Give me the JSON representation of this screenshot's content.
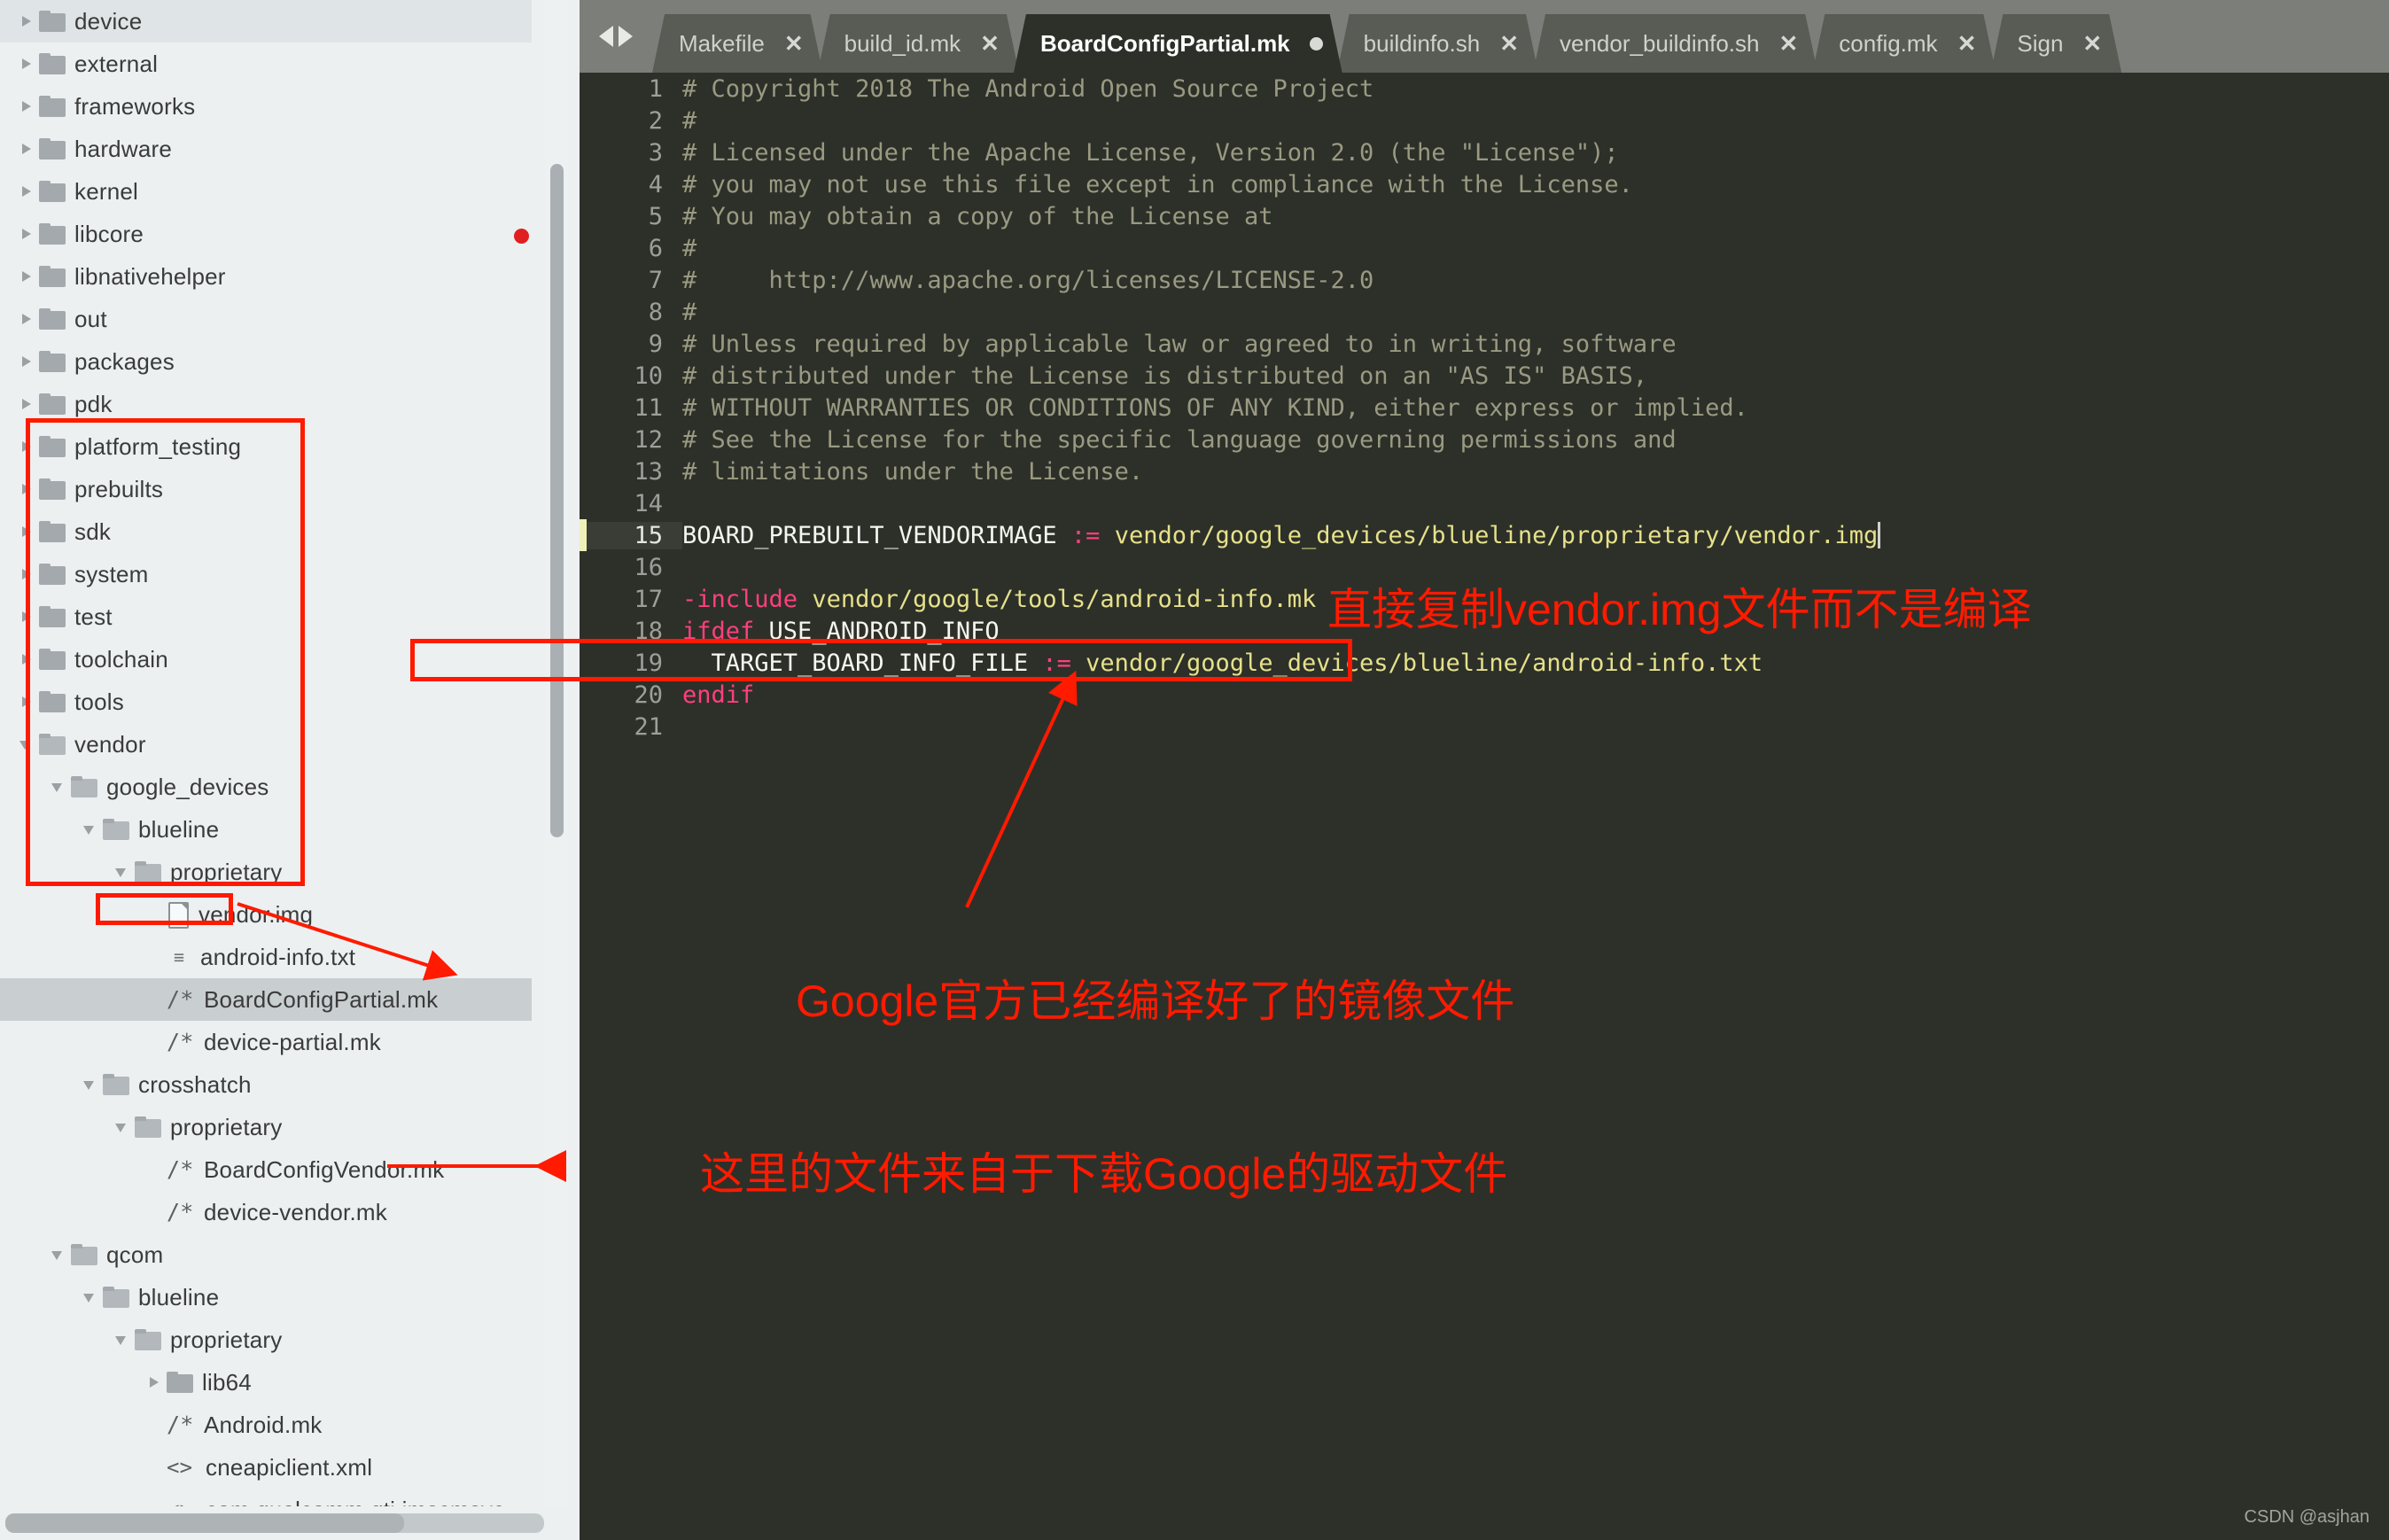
{
  "tree": {
    "items": [
      {
        "label": "device",
        "type": "folder",
        "depth": 1,
        "state": "collapsed",
        "selected": false,
        "hover": true,
        "error": false
      },
      {
        "label": "external",
        "type": "folder",
        "depth": 1,
        "state": "collapsed",
        "selected": false,
        "hover": false,
        "error": false
      },
      {
        "label": "frameworks",
        "type": "folder",
        "depth": 1,
        "state": "collapsed",
        "selected": false,
        "hover": false,
        "error": false
      },
      {
        "label": "hardware",
        "type": "folder",
        "depth": 1,
        "state": "collapsed",
        "selected": false,
        "hover": false,
        "error": false
      },
      {
        "label": "kernel",
        "type": "folder",
        "depth": 1,
        "state": "collapsed",
        "selected": false,
        "hover": false,
        "error": false
      },
      {
        "label": "libcore",
        "type": "folder",
        "depth": 1,
        "state": "collapsed",
        "selected": false,
        "hover": false,
        "error": true
      },
      {
        "label": "libnativehelper",
        "type": "folder",
        "depth": 1,
        "state": "collapsed",
        "selected": false,
        "hover": false,
        "error": false
      },
      {
        "label": "out",
        "type": "folder",
        "depth": 1,
        "state": "collapsed",
        "selected": false,
        "hover": false,
        "error": false
      },
      {
        "label": "packages",
        "type": "folder",
        "depth": 1,
        "state": "collapsed",
        "selected": false,
        "hover": false,
        "error": false
      },
      {
        "label": "pdk",
        "type": "folder",
        "depth": 1,
        "state": "collapsed",
        "selected": false,
        "hover": false,
        "error": false
      },
      {
        "label": "platform_testing",
        "type": "folder",
        "depth": 1,
        "state": "collapsed",
        "selected": false,
        "hover": false,
        "error": false
      },
      {
        "label": "prebuilts",
        "type": "folder",
        "depth": 1,
        "state": "collapsed",
        "selected": false,
        "hover": false,
        "error": false
      },
      {
        "label": "sdk",
        "type": "folder",
        "depth": 1,
        "state": "collapsed",
        "selected": false,
        "hover": false,
        "error": false
      },
      {
        "label": "system",
        "type": "folder",
        "depth": 1,
        "state": "collapsed",
        "selected": false,
        "hover": false,
        "error": false
      },
      {
        "label": "test",
        "type": "folder",
        "depth": 1,
        "state": "collapsed",
        "selected": false,
        "hover": false,
        "error": false
      },
      {
        "label": "toolchain",
        "type": "folder",
        "depth": 1,
        "state": "collapsed",
        "selected": false,
        "hover": false,
        "error": false
      },
      {
        "label": "tools",
        "type": "folder",
        "depth": 1,
        "state": "collapsed",
        "selected": false,
        "hover": false,
        "error": false
      },
      {
        "label": "vendor",
        "type": "folder",
        "depth": 1,
        "state": "expanded",
        "selected": false,
        "hover": false,
        "error": false
      },
      {
        "label": "google_devices",
        "type": "folder",
        "depth": 2,
        "state": "expanded",
        "selected": false,
        "hover": false,
        "error": false
      },
      {
        "label": "blueline",
        "type": "folder",
        "depth": 3,
        "state": "expanded",
        "selected": false,
        "hover": false,
        "error": false
      },
      {
        "label": "proprietary",
        "type": "folder",
        "depth": 4,
        "state": "expanded",
        "selected": false,
        "hover": false,
        "error": false
      },
      {
        "label": "vendor.img",
        "type": "file",
        "depth": 5,
        "state": "none",
        "selected": false,
        "hover": false,
        "error": false
      },
      {
        "label": "android-info.txt",
        "type": "txt",
        "depth": 5,
        "state": "none",
        "selected": false,
        "hover": false,
        "error": false
      },
      {
        "label": "BoardConfigPartial.mk",
        "type": "mk",
        "depth": 5,
        "state": "none",
        "selected": true,
        "hover": false,
        "error": false
      },
      {
        "label": "device-partial.mk",
        "type": "mk",
        "depth": 5,
        "state": "none",
        "selected": false,
        "hover": false,
        "error": false
      },
      {
        "label": "crosshatch",
        "type": "folder",
        "depth": 3,
        "state": "expanded",
        "selected": false,
        "hover": false,
        "error": false
      },
      {
        "label": "proprietary",
        "type": "folder",
        "depth": 4,
        "state": "expanded",
        "selected": false,
        "hover": false,
        "error": false
      },
      {
        "label": "BoardConfigVendor.mk",
        "type": "mk",
        "depth": 5,
        "state": "none",
        "selected": false,
        "hover": false,
        "error": false
      },
      {
        "label": "device-vendor.mk",
        "type": "mk",
        "depth": 5,
        "state": "none",
        "selected": false,
        "hover": false,
        "error": false
      },
      {
        "label": "qcom",
        "type": "folder",
        "depth": 2,
        "state": "expanded",
        "selected": false,
        "hover": false,
        "error": false
      },
      {
        "label": "blueline",
        "type": "folder",
        "depth": 3,
        "state": "expanded",
        "selected": false,
        "hover": false,
        "error": false
      },
      {
        "label": "proprietary",
        "type": "folder",
        "depth": 4,
        "state": "expanded",
        "selected": false,
        "hover": false,
        "error": false
      },
      {
        "label": "lib64",
        "type": "folder",
        "depth": 5,
        "state": "collapsed",
        "selected": false,
        "hover": false,
        "error": false
      },
      {
        "label": "Android.mk",
        "type": "mk",
        "depth": 5,
        "state": "none",
        "selected": false,
        "hover": false,
        "error": false
      },
      {
        "label": "cneapiclient.xml",
        "type": "xml",
        "depth": 5,
        "state": "none",
        "selected": false,
        "hover": false,
        "error": false
      },
      {
        "label": "com.qualcomm.qti.imscmsvc",
        "type": "xml",
        "depth": 5,
        "state": "none",
        "selected": false,
        "hover": false,
        "error": false
      }
    ]
  },
  "tabs": {
    "nav_back": "◀",
    "nav_forward": "▶",
    "items": [
      {
        "label": "Makefile",
        "active": false,
        "modified": false,
        "close": "✕"
      },
      {
        "label": "build_id.mk",
        "active": false,
        "modified": false,
        "close": "✕"
      },
      {
        "label": "BoardConfigPartial.mk",
        "active": true,
        "modified": true,
        "close": "✕"
      },
      {
        "label": "buildinfo.sh",
        "active": false,
        "modified": false,
        "close": "✕"
      },
      {
        "label": "vendor_buildinfo.sh",
        "active": false,
        "modified": false,
        "close": "✕"
      },
      {
        "label": "config.mk",
        "active": false,
        "modified": false,
        "close": "✕"
      },
      {
        "label": "Sign",
        "active": false,
        "modified": false,
        "close": "✕"
      }
    ]
  },
  "editor": {
    "lines": [
      {
        "n": "1",
        "current": false,
        "spans": [
          {
            "t": "# Copyright 2018 The Android Open Source Project",
            "c": "c-comment"
          }
        ]
      },
      {
        "n": "2",
        "current": false,
        "spans": [
          {
            "t": "#",
            "c": "c-comment"
          }
        ]
      },
      {
        "n": "3",
        "current": false,
        "spans": [
          {
            "t": "# Licensed under the Apache License, Version 2.0 (the \"License\");",
            "c": "c-comment"
          }
        ]
      },
      {
        "n": "4",
        "current": false,
        "spans": [
          {
            "t": "# you may not use this file except in compliance with the License.",
            "c": "c-comment"
          }
        ]
      },
      {
        "n": "5",
        "current": false,
        "spans": [
          {
            "t": "# You may obtain a copy of the License at",
            "c": "c-comment"
          }
        ]
      },
      {
        "n": "6",
        "current": false,
        "spans": [
          {
            "t": "#",
            "c": "c-comment"
          }
        ]
      },
      {
        "n": "7",
        "current": false,
        "spans": [
          {
            "t": "#     http://www.apache.org/licenses/LICENSE-2.0",
            "c": "c-comment"
          }
        ]
      },
      {
        "n": "8",
        "current": false,
        "spans": [
          {
            "t": "#",
            "c": "c-comment"
          }
        ]
      },
      {
        "n": "9",
        "current": false,
        "spans": [
          {
            "t": "# Unless required by applicable law or agreed to in writing, software",
            "c": "c-comment"
          }
        ]
      },
      {
        "n": "10",
        "current": false,
        "spans": [
          {
            "t": "# distributed under the License is distributed on an \"AS IS\" BASIS,",
            "c": "c-comment"
          }
        ]
      },
      {
        "n": "11",
        "current": false,
        "spans": [
          {
            "t": "# WITHOUT WARRANTIES OR CONDITIONS OF ANY KIND, either express or implied.",
            "c": "c-comment"
          }
        ]
      },
      {
        "n": "12",
        "current": false,
        "spans": [
          {
            "t": "# See the License for the specific language governing permissions and",
            "c": "c-comment"
          }
        ]
      },
      {
        "n": "13",
        "current": false,
        "spans": [
          {
            "t": "# limitations under the License.",
            "c": "c-comment"
          }
        ]
      },
      {
        "n": "14",
        "current": false,
        "spans": []
      },
      {
        "n": "15",
        "current": true,
        "spans": [
          {
            "t": "BOARD_PREBUILT_VENDORIMAGE ",
            "c": "c-var"
          },
          {
            "t": ":= ",
            "c": "c-op"
          },
          {
            "t": "vendor/google_devices/blueline/proprietary/vendor.img",
            "c": "c-path"
          },
          {
            "t": "|",
            "c": "c-caret"
          }
        ]
      },
      {
        "n": "16",
        "current": false,
        "spans": []
      },
      {
        "n": "17",
        "current": false,
        "spans": [
          {
            "t": "-include ",
            "c": "c-kw"
          },
          {
            "t": "vendor/google/tools/android-info.mk",
            "c": "c-path"
          }
        ]
      },
      {
        "n": "18",
        "current": false,
        "spans": [
          {
            "t": "ifdef ",
            "c": "c-kw"
          },
          {
            "t": "USE_ANDROID_INFO",
            "c": "c-var"
          }
        ]
      },
      {
        "n": "19",
        "current": false,
        "spans": [
          {
            "t": "  TARGET_BOARD_INFO_FILE ",
            "c": "c-var"
          },
          {
            "t": ":= ",
            "c": "c-op"
          },
          {
            "t": "vendor/google_devices/blueline/android-info.txt",
            "c": "c-path"
          }
        ]
      },
      {
        "n": "20",
        "current": false,
        "spans": [
          {
            "t": "endif",
            "c": "c-kw"
          }
        ]
      },
      {
        "n": "21",
        "current": false,
        "spans": []
      }
    ]
  },
  "annotations": {
    "note_copy_vendor_img": "直接复制vendor.img文件而不是编译",
    "note_google_prebuilt": "Google官方已经编译好了的镜像文件",
    "note_driver_download": "这里的文件来自于下载Google的驱动文件",
    "accent_color": "#ff1a00"
  },
  "watermark": "CSDN @asjhan"
}
